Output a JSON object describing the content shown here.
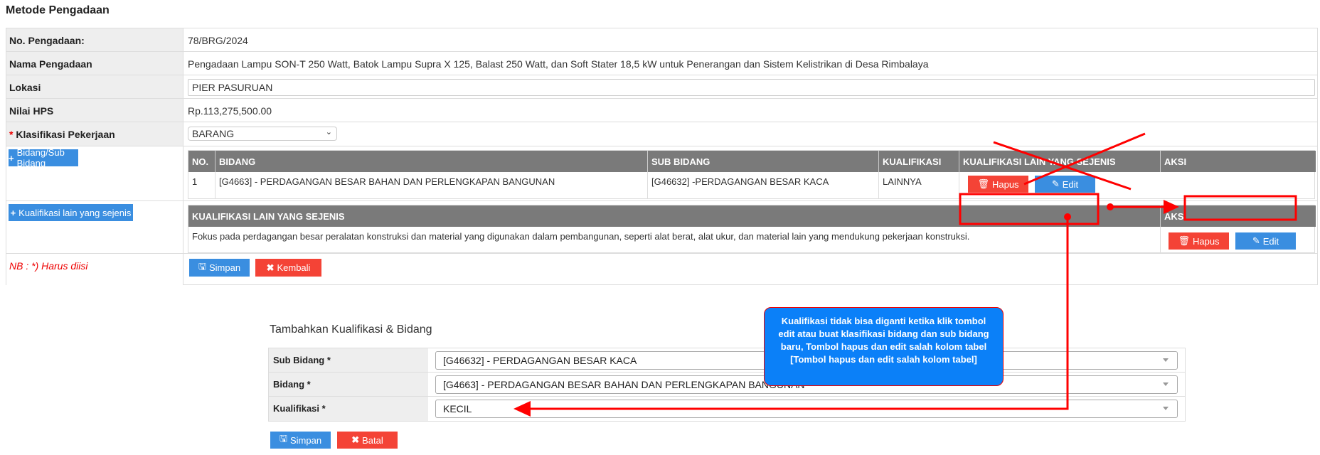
{
  "page_title": "Metode Pengadaan",
  "fields": {
    "no_label": "No. Pengadaan:",
    "no_value": "78/BRG/2024",
    "nama_label": "Nama Pengadaan",
    "nama_value": "Pengadaan Lampu SON-T 250 Watt, Batok Lampu Supra X 125, Balast 250 Watt, dan Soft Stater 18,5 kW untuk Penerangan dan Sistem Kelistrikan di Desa Rimbalaya",
    "lokasi_label": "Lokasi",
    "lokasi_value": "PIER PASURUAN",
    "hps_label": "Nilai HPS",
    "hps_value": "Rp.113,275,500.00",
    "klasifikasi_required": "*",
    "klasifikasi_label": "Klasifikasi Pekerjaan",
    "klasifikasi_value": "BARANG"
  },
  "bidang_button": "Bidang/Sub Bidang",
  "bidang_table": {
    "headers": [
      "NO.",
      "BIDANG",
      "SUB BIDANG",
      "KUALIFIKASI",
      "KUALIFIKASI LAIN YANG SEJENIS",
      "AKSI"
    ],
    "rows": [
      {
        "no": "1",
        "bidang": "[G4663] - PERDAGANGAN BESAR BAHAN DAN PERLENGKAPAN BANGUNAN",
        "sub": "[G46632] -PERDAGANGAN BESAR KACA",
        "kualifikasi": "LAINNYA",
        "hapus": "Hapus",
        "edit": "Edit"
      }
    ]
  },
  "kualifikasi_button": "Kualifikasi lain yang sejenis",
  "kualifikasi_table": {
    "headers": [
      "KUALIFIKASI LAIN YANG SEJENIS",
      "AKSI"
    ],
    "row": {
      "text": "Fokus pada perdagangan besar peralatan konstruksi dan material yang digunakan dalam pembangunan, seperti alat berat, alat ukur, dan material lain yang mendukung pekerjaan konstruksi.",
      "hapus": "Hapus",
      "edit": "Edit"
    }
  },
  "note": "NB : *) Harus diisi",
  "simpan": "Simpan",
  "kembali": "Kembali",
  "form": {
    "title": "Tambahkan Kualifikasi & Bidang",
    "sub_label": "Sub Bidang *",
    "sub_value": "[G46632] - PERDAGANGAN BESAR KACA",
    "bidang_label": "Bidang *",
    "bidang_value": "[G4663] - PERDAGANGAN BESAR BAHAN DAN PERLENGKAPAN BANGUNAN",
    "kual_label": "Kualifikasi *",
    "kual_value": "KECIL",
    "simpan": "Simpan",
    "batal": "Batal"
  },
  "annotation": "Kualifikasi tidak bisa diganti ketika klik tombol edit atau buat klasifikasi bidang dan sub bidang baru, Tombol hapus dan edit salah kolom tabel [Tombol hapus dan edit salah kolom tabel]",
  "colors": {
    "primary": "#3a8ee0",
    "danger": "#f44336",
    "annotation": "#ff0000",
    "callout": "#0b80f8"
  }
}
